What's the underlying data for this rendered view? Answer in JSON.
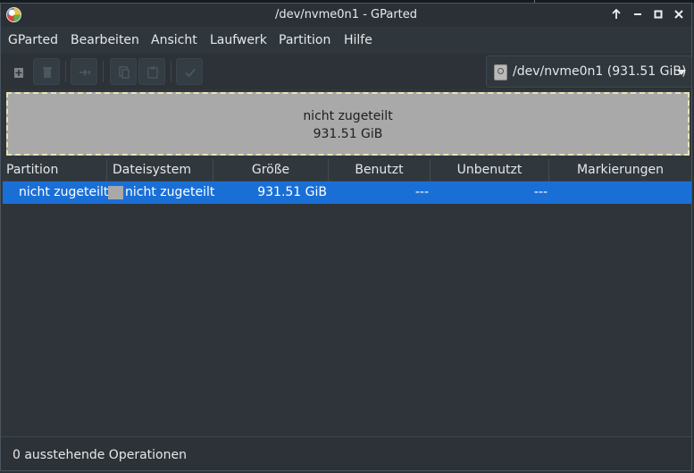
{
  "window": {
    "title": "/dev/nvme0n1 - GParted",
    "controls": [
      "arrow-up-icon",
      "minimize-icon",
      "maximize-icon",
      "close-icon"
    ]
  },
  "menubar": {
    "items": [
      "GParted",
      "Bearbeiten",
      "Ansicht",
      "Laufwerk",
      "Partition",
      "Hilfe"
    ]
  },
  "toolbar": {
    "buttons": [
      "new-partition-icon",
      "delete-icon",
      "resize-move-icon",
      "copy-icon",
      "paste-icon",
      "apply-icon"
    ],
    "device_selector": "/dev/nvme0n1 (931.51 GiB)"
  },
  "diskmap": {
    "label": "nicht zugeteilt",
    "size": "931.51 GiB",
    "fill_color": "#a9a9a9",
    "border_color": "#e9e6b0"
  },
  "table": {
    "columns": [
      "Partition",
      "Dateisystem",
      "Größe",
      "Benutzt",
      "Unbenutzt",
      "Markierungen"
    ],
    "rows": [
      {
        "partition": "nicht zugeteilt",
        "filesystem": "nicht zugeteilt",
        "size": "931.51 GiB",
        "used": "---",
        "unused": "---",
        "flags": ""
      }
    ],
    "selected_color": "#1a6fd6"
  },
  "statusbar": {
    "text": "0 ausstehende Operationen"
  }
}
